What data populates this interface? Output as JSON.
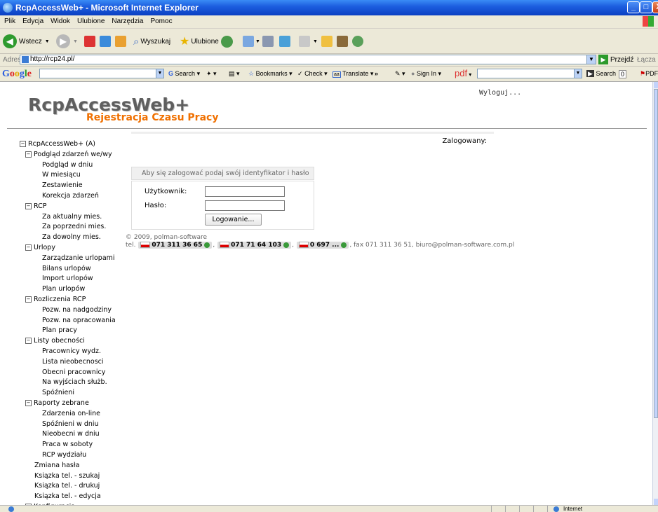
{
  "window": {
    "title": "RcpAccessWeb+ - Microsoft Internet Explorer",
    "minimize": "_",
    "maximize": "□",
    "close": "X"
  },
  "menu": [
    "Plik",
    "Edycja",
    "Widok",
    "Ulubione",
    "Narzędzia",
    "Pomoc"
  ],
  "toolbar": {
    "back": "Wstecz",
    "search": "Wyszukaj",
    "favorites": "Ulubione"
  },
  "address": {
    "label": "Adres",
    "url": "http://rcp24.pl/",
    "go": "Przejdź",
    "links": "Łącza"
  },
  "google": {
    "logo": [
      "G",
      "o",
      "o",
      "g",
      "l",
      "e"
    ],
    "search": "Search",
    "bookmarks": "Bookmarks",
    "check": "Check",
    "translate": "Translate",
    "more": "»",
    "signin": "Sign In",
    "pdf": "pdf",
    "search2": "Search",
    "count": "0",
    "pdf2": "PDF"
  },
  "app": {
    "logo_main": "RcpAccessWeb+",
    "logo_sub": "Rejestracja Czasu Pracy",
    "logout": "Wyloguj...",
    "logged_in": "Zalogowany:"
  },
  "tree": [
    {
      "level": "l0",
      "toggle": true,
      "label": "RcpAccessWeb+ (A)"
    },
    {
      "level": "l1",
      "toggle": true,
      "label": "Podgląd zdarzeń we/wy"
    },
    {
      "level": "l2",
      "label": "Podgląd w dniu"
    },
    {
      "level": "l2",
      "label": "W miesiącu"
    },
    {
      "level": "l2",
      "label": "Zestawienie"
    },
    {
      "level": "l2",
      "label": "Korekcja zdarzeń"
    },
    {
      "level": "l1",
      "toggle": true,
      "label": "RCP"
    },
    {
      "level": "l2",
      "label": "Za aktualny mies."
    },
    {
      "level": "l2",
      "label": "Za poprzedni mies."
    },
    {
      "level": "l2",
      "label": "Za dowolny mies."
    },
    {
      "level": "l1",
      "toggle": true,
      "label": "Urlopy"
    },
    {
      "level": "l2",
      "label": "Zarządzanie urlopami"
    },
    {
      "level": "l2",
      "label": "Bilans urlopów"
    },
    {
      "level": "l2",
      "label": "Import urlopów"
    },
    {
      "level": "l2",
      "label": "Plan urlopów"
    },
    {
      "level": "l1",
      "toggle": true,
      "label": "Rozliczenia RCP"
    },
    {
      "level": "l2",
      "label": "Pozw. na nadgodziny"
    },
    {
      "level": "l2",
      "label": "Pozw. na opracowania"
    },
    {
      "level": "l2",
      "label": "Plan pracy"
    },
    {
      "level": "l1",
      "toggle": true,
      "label": "Listy obecności"
    },
    {
      "level": "l2",
      "label": "Pracownicy wydz."
    },
    {
      "level": "l2",
      "label": "Lista nieobecnosci"
    },
    {
      "level": "l2",
      "label": "Obecni pracownicy"
    },
    {
      "level": "l2",
      "label": "Na wyjściach służb."
    },
    {
      "level": "l2",
      "label": "Spóźnieni"
    },
    {
      "level": "l1",
      "toggle": true,
      "label": "Raporty zebrane"
    },
    {
      "level": "l2",
      "label": "Zdarzenia on-line"
    },
    {
      "level": "l2",
      "label": "Spóźnieni w dniu"
    },
    {
      "level": "l2",
      "label": "Nieobecni w dniu"
    },
    {
      "level": "l2",
      "label": "Praca w soboty"
    },
    {
      "level": "l2",
      "label": "RCP wydziału"
    },
    {
      "level": "l1p",
      "label": "Zmiana hasła"
    },
    {
      "level": "l1p",
      "label": "Ksiązka tel. - szukaj"
    },
    {
      "level": "l1p",
      "label": "Ksiązka tel. - drukuj"
    },
    {
      "level": "l1p",
      "label": "Ksiązka tel. - edycja"
    },
    {
      "level": "l1",
      "toggle": true,
      "label": "Konfiguracja"
    }
  ],
  "login": {
    "tab": "Aby się zalogować podaj swój identyfikator i hasło",
    "user_label": "Użytkownik:",
    "pass_label": "Hasło:",
    "button": "Logowanie..."
  },
  "footer": {
    "copyright": "© 2009, polman-software",
    "tel_prefix": "tel.",
    "phones": [
      "071 311 36 65",
      "071 71 64 103",
      "0 697 ..."
    ],
    "rest": ", fax 071 311 36 51, biuro@polman-software.com.pl"
  },
  "statusbar": {
    "zone": "Internet"
  }
}
